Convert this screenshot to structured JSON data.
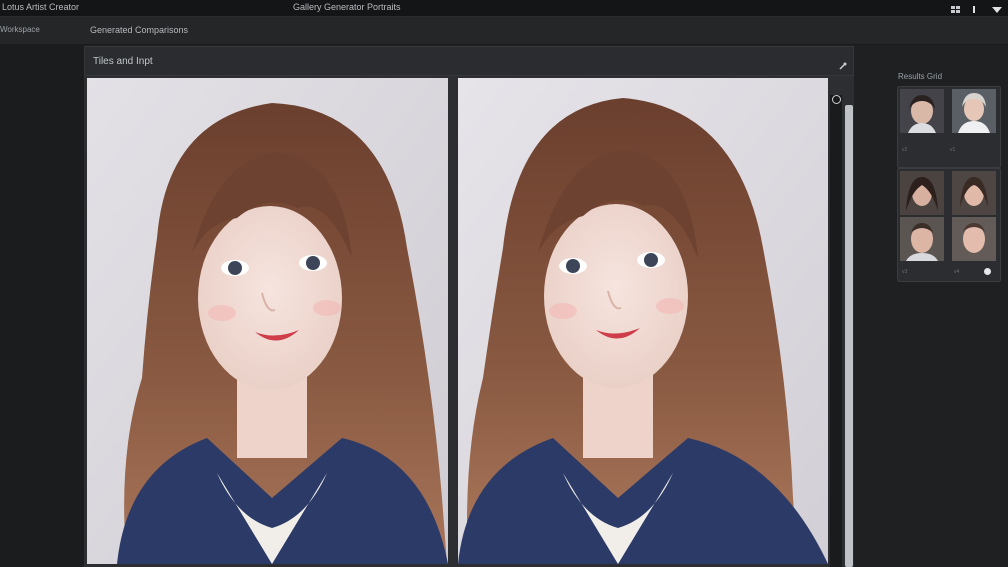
{
  "window": {
    "app_title": "Lotus Artist Creator",
    "document_title": "Gallery Generator Portraits"
  },
  "menubar": {
    "left_label": "Workspace",
    "main_label": "Generated Comparisons"
  },
  "viewer": {
    "label": "Tiles and Inpt"
  },
  "side_panel": {
    "title": "Results Grid",
    "group1_captions": [
      "v2",
      "v1"
    ],
    "group2_captions": [
      "v3",
      "v4"
    ]
  },
  "colors": {
    "background": "#1e2022",
    "panel": "#2a2c2f",
    "photo_backdrop": "#d8d6dc",
    "hair": "#7a4a36",
    "sweater": "#2d3a66"
  }
}
